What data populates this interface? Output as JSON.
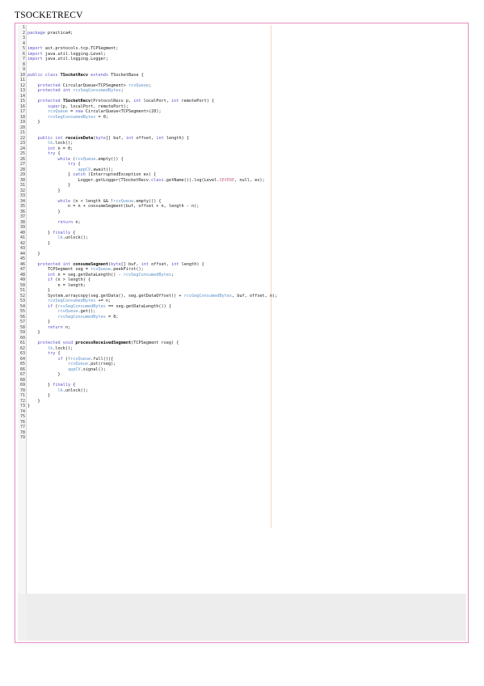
{
  "document": {
    "title": "TSOCKETRECV"
  },
  "editor": {
    "code_lines": [
      "",
      "package practica4;",
      "",
      "",
      "import ast.protocols.tcp.TCPSegment;",
      "import java.util.logging.Level;",
      "import java.util.logging.Logger;",
      "",
      "",
      "public class TSocketRecv extends TSocketBase {",
      "",
      "    protected CircularQueue<TCPSegment> rcvQueue;",
      "    protected int rcvSegConsumedBytes;",
      "",
      "    protected TSocketRecv(ProtocolRecv p, int localPort, int remotePort) {",
      "        super(p, localPort, remotePort);",
      "        rcvQueue = new CircularQueue<TCPSegment>(20);",
      "        rcvSegConsumedBytes = 0;",
      "    }",
      "",
      "",
      "    public int receiveData(byte[] buf, int offset, int length) {",
      "        lk.lock();",
      "        int n = 0;",
      "        try {",
      "            while (rcvQueue.empty()) {",
      "                try {",
      "                    appCV.await();",
      "                } catch (InterruptedException ex) {",
      "                    Logger.getLogger(TSocketRecv.class.getName()).log(Level.SEVERE, null, ex);",
      "                }",
      "            }",
      "",
      "            while (n < length && !rcvQueue.empty()) {",
      "                n = n + consumeSegment(buf, offset + n, length - n);",
      "            }",
      "",
      "            return n;",
      "",
      "        } finally {",
      "            lk.unlock();",
      "        }",
      "",
      "    }",
      "",
      "    protected int consumeSegment(byte[] buf, int offset, int length) {",
      "        TCPSegment seg = rcvQueue.peekFirst();",
      "        int n = seg.getDataLength() - rcvSegConsumedBytes;",
      "        if (n > length) {",
      "            n = length;",
      "        }",
      "        System.arraycopy(seg.getData(), seg.getDataOffset() + rcvSegConsumedBytes, buf, offset, n);",
      "        rcvSegConsumedBytes += n;",
      "        if (rcvSegConsumedBytes == seg.getDataLength()) {",
      "            rcvQueue.get();",
      "            rcvSegConsumedBytes = 0;",
      "        }",
      "        return n;",
      "    }",
      "",
      "    protected void processReceivedSegment(TCPSegment rseg) {",
      "        lk.lock();",
      "        try {",
      "            if (!rcvQueue.full()){",
      "                rcvQueue.put(rseg);",
      "                appCV.signal();",
      "            }",
      "",
      "        } finally {",
      "            lk.unlock();",
      "        }",
      "    }",
      "}",
      "",
      "",
      "",
      "",
      "",
      ""
    ]
  }
}
